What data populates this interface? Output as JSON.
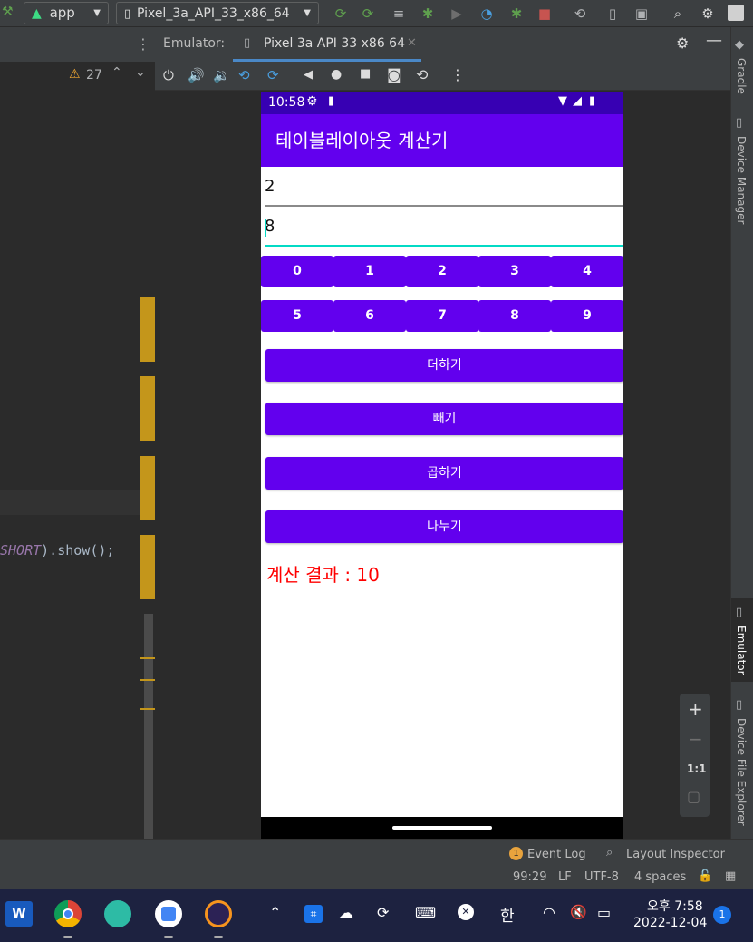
{
  "toolbar": {
    "module": "app",
    "device": "Pixel_3a_API_33_x86_64"
  },
  "editor": {
    "warnings_count": "27",
    "code_prefix": "SHORT",
    "code_suffix": ").show();"
  },
  "emulator": {
    "panel_label": "Emulator:",
    "tab_label": "Pixel 3a API 33 x86 64"
  },
  "right_stripe": {
    "gradle": "Gradle",
    "device_manager": "Device Manager",
    "emulator": "Emulator",
    "device_file_explorer": "Device File Explorer"
  },
  "phone": {
    "time": "10:58",
    "app_title": "테이블레이아웃 계산기",
    "input1": "2",
    "input2": "8",
    "digits_row1": [
      "0",
      "1",
      "2",
      "3",
      "4"
    ],
    "digits_row2": [
      "5",
      "6",
      "7",
      "8",
      "9"
    ],
    "btn_add": "더하기",
    "btn_sub": "빼기",
    "btn_mul": "곱하기",
    "btn_div": "나누기",
    "result": "계산 결과 : 10",
    "colors": {
      "primary": "#6200ee",
      "primary_dark": "#3700b3",
      "result": "#ff0000",
      "accent": "#03dac5"
    }
  },
  "zoom": {
    "one_to_one": "1:1"
  },
  "bottom": {
    "event_log": "Event Log",
    "event_count": "1",
    "layout_inspector": "Layout Inspector",
    "position": "99:29",
    "line_sep": "LF",
    "encoding": "UTF-8",
    "indent": "4 spaces"
  },
  "taskbar": {
    "ampm_time": "오후 7:58",
    "date": "2022-12-04",
    "ime": "한",
    "notif_count": "1"
  }
}
